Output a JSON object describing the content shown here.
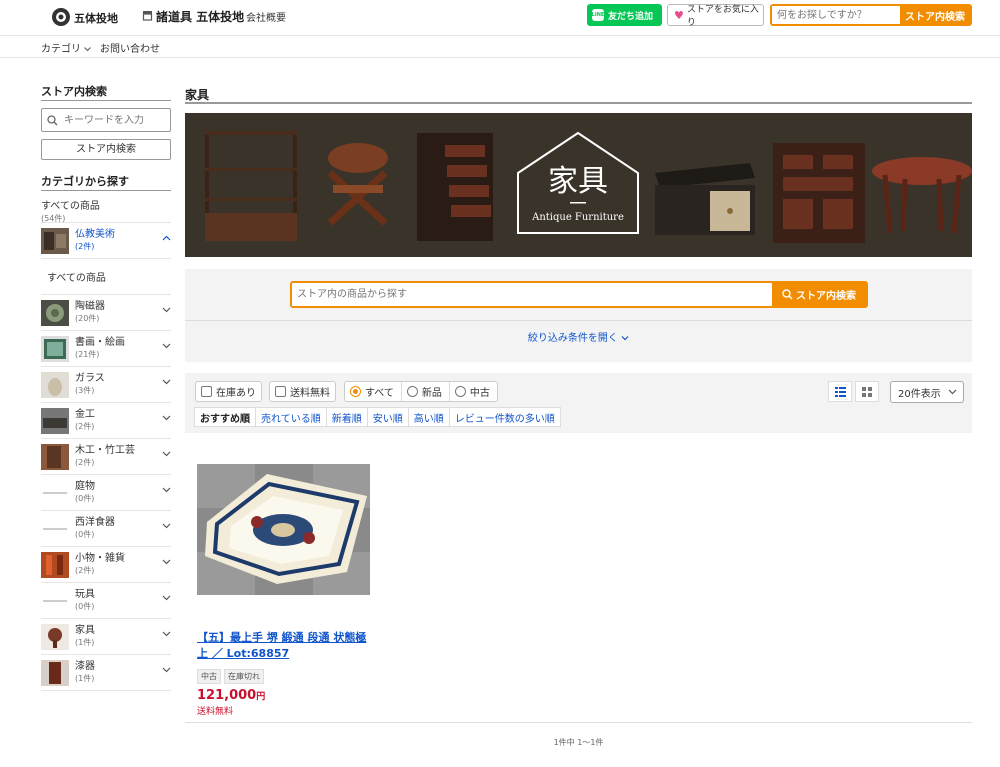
{
  "header": {
    "logo_text": "五体投地",
    "store_name": "諸道具 五体投地",
    "company_link": "会社概要",
    "line_button": "友だち追加",
    "line_icon_text": "LINE",
    "favorite_button": "ストアをお気に入り",
    "search_placeholder": "何をお探しですか？",
    "search_button": "ストア内検索"
  },
  "subnav": {
    "category": "カテゴリ",
    "inquiry": "お問い合わせ"
  },
  "sidebar": {
    "store_search_title": "ストア内検索",
    "keyword_placeholder": "キーワードを入力",
    "store_search_button": "ストア内検索",
    "category_title": "カテゴリから探す",
    "all_items": {
      "label": "すべての商品",
      "count": "(54件)"
    },
    "sub_all": "すべての商品",
    "categories": [
      {
        "label": "仏教美術",
        "count": "(2件)",
        "active": true
      },
      {
        "label": "陶磁器",
        "count": "(20件)"
      },
      {
        "label": "書画・絵画",
        "count": "(21件)"
      },
      {
        "label": "ガラス",
        "count": "(3件)"
      },
      {
        "label": "金工",
        "count": "(2件)"
      },
      {
        "label": "木工・竹工芸",
        "count": "(2件)"
      },
      {
        "label": "庭物",
        "count": "(0件)"
      },
      {
        "label": "西洋食器",
        "count": "(0件)"
      },
      {
        "label": "小物・雑貨",
        "count": "(2件)"
      },
      {
        "label": "玩具",
        "count": "(0件)"
      },
      {
        "label": "家具",
        "count": "(1件)"
      },
      {
        "label": "漆器",
        "count": "(1件)"
      }
    ]
  },
  "main": {
    "title": "家具",
    "banner": {
      "kanji": "家具",
      "subtitle": "Antique Furniture"
    },
    "search_placeholder": "ストア内の商品から探す",
    "search_button": "ストア内検索",
    "filter_link": "絞り込み条件を開く",
    "filters": {
      "in_stock": "在庫あり",
      "free_shipping": "送料無料"
    },
    "conditions": [
      "すべて",
      "新品",
      "中古"
    ],
    "sort_options": [
      "おすすめ順",
      "売れている順",
      "新着順",
      "安い順",
      "高い順",
      "レビュー件数の多い順"
    ],
    "per_page": "20件表示",
    "product": {
      "title": "【五】最上手 堺 緞通 段通 状態極上 ／ Lot:68857",
      "tags": [
        "中古",
        "在庫切れ"
      ],
      "price": "121,000",
      "price_unit": "円",
      "shipping": "送料無料"
    },
    "pager": "1件中 1〜1件"
  },
  "colors": {
    "accent": "#f28c00",
    "line_green": "#06c755",
    "link": "#1155cc",
    "price": "#c8102e"
  }
}
